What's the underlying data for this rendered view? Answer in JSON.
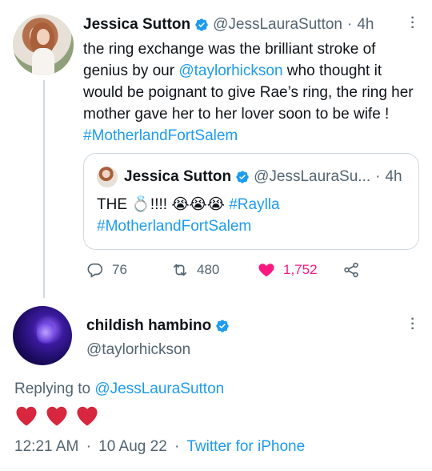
{
  "tweet": {
    "author_name": "Jessica Sutton",
    "author_handle": "@JessLauraSutton",
    "separator": "·",
    "time": "4h",
    "text_part1": "the ring exchange was the brilliant stroke of genius by our ",
    "mention": "@taylorhickson",
    "text_part2": " who thought it would be poignant to give Rae’s ring, the ring her mother gave her to her lover soon to be wife ! ",
    "hashtag": "#MotherlandFortSalem",
    "quote": {
      "author_name": "Jessica Sutton",
      "author_handle": "@JessLauraSu...",
      "separator": "·",
      "time": "4h",
      "text_part1": "THE 💍!!!! 😭😭😭 ",
      "hashtag1": "#Raylla",
      "hashtag2": "#MotherlandFortSalem"
    },
    "actions": {
      "replies": "76",
      "retweets": "480",
      "likes": "1,752"
    }
  },
  "reply": {
    "author_name": "childish hambino",
    "author_handle": "@taylorhickson",
    "replying_label": "Replying to ",
    "replying_to": "@JessLauraSutton",
    "time": "12:21 AM",
    "date": "10 Aug 22",
    "separator": "·",
    "source": "Twitter for iPhone"
  },
  "colors": {
    "link": "#1d9bf0",
    "verified": "#1d9bf0",
    "like": "#f91880",
    "heart_emoji": "#d7263d",
    "muted": "#536471"
  },
  "icons": [
    "verified-badge-icon",
    "more-icon",
    "reply-icon",
    "retweet-icon",
    "heart-icon",
    "share-icon",
    "red-heart-icon"
  ]
}
